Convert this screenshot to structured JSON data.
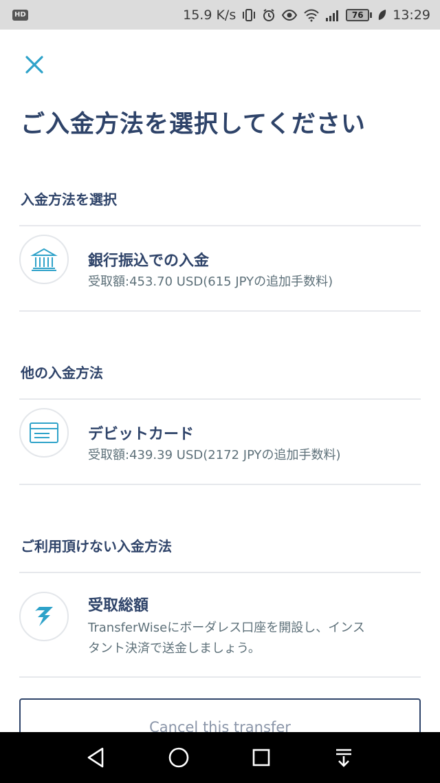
{
  "status_bar": {
    "hd": "HD",
    "speed": "15.9 K/s",
    "battery": "76",
    "time": "13:29"
  },
  "page_title": "ご入金方法を選択してください",
  "sections": {
    "select_label": "入金方法を選択",
    "other_label": "他の入金方法",
    "unavailable_label": "ご利用頂けない入金方法"
  },
  "options": {
    "bank": {
      "icon": "bank-icon",
      "title": "銀行振込での入金",
      "subtitle": "受取額:453.70 USD(615 JPYの追加手数料)"
    },
    "debit": {
      "icon": "debit-card-icon",
      "title": "デビットカード",
      "subtitle": "受取額:439.39 USD(2172 JPYの追加手数料)"
    },
    "transferwise": {
      "icon": "transferwise-logo-icon",
      "title": "受取総額",
      "subtitle_line1": "TransferWiseにボーダレス口座を開設し、インス",
      "subtitle_line2": "タント決済で送金しましょう。"
    }
  },
  "cancel_label": "Cancel this transfer",
  "colors": {
    "accent": "#2ea2c9",
    "title": "#2e4369",
    "muted": "#5d7079",
    "divider": "#e6e8ec"
  }
}
